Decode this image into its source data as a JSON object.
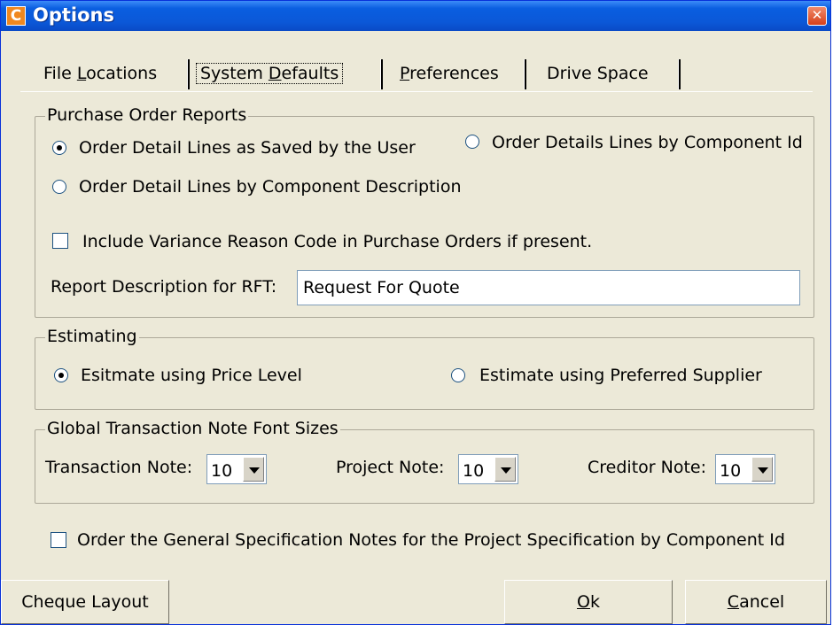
{
  "window": {
    "title": "Options",
    "icon_letter": "C",
    "close_glyph": "✕",
    "title_color": "#0a5ee0",
    "icon_color": "#f08820"
  },
  "tabs": [
    {
      "pre": "File ",
      "u": "L",
      "post": "ocations",
      "active": false
    },
    {
      "pre": "System ",
      "u": "D",
      "post": "efaults",
      "active": true
    },
    {
      "pre": "",
      "u": "P",
      "post": "references",
      "active": false
    },
    {
      "pre": "Drive Space",
      "u": "",
      "post": "",
      "active": false
    }
  ],
  "purchase_order_reports": {
    "legend": "Purchase Order Reports",
    "radio_saved_by_user": "Order Detail Lines as Saved by the User",
    "radio_by_component_id": "Order Details Lines by Component Id",
    "radio_by_component_desc": "Order Detail Lines by Component Description",
    "selected": "saved_by_user",
    "variance_checkbox_label": "Include Variance Reason Code in Purchase Orders if present.",
    "variance_checked": false,
    "rft_label": "Report Description for RFT:",
    "rft_value": "Request For Quote"
  },
  "estimating": {
    "legend": "Estimating",
    "radio_price_level": "Esitmate using Price Level",
    "radio_preferred_supplier": "Estimate using Preferred Supplier",
    "selected": "price_level"
  },
  "font_sizes": {
    "legend": "Global Transaction Note Font Sizes",
    "transaction_label": "Transaction Note:",
    "transaction_value": "10",
    "project_label": "Project Note:",
    "project_value": "10",
    "creditor_label": "Creditor Note:",
    "creditor_value": "10"
  },
  "spec_notes": {
    "label": "Order the General Specification Notes for the Project Specification by Component Id",
    "checked": false
  },
  "buttons": {
    "cheque_layout": "Cheque Layout",
    "ok_u": "O",
    "ok_rest": "k",
    "cancel_u": "C",
    "cancel_rest": "ancel"
  }
}
